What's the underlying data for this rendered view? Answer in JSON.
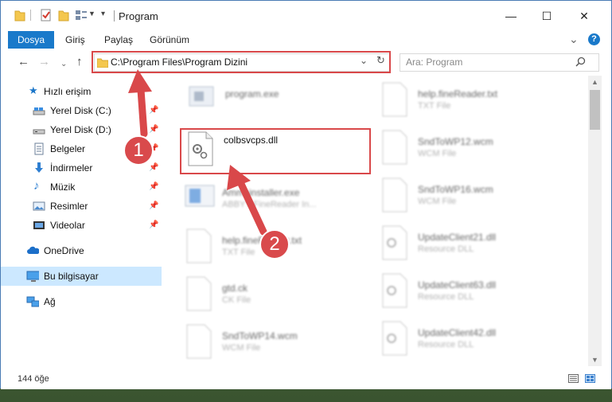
{
  "window": {
    "title": "Program"
  },
  "ribbon": {
    "tabs": {
      "file": "Dosya",
      "home": "Giriş",
      "share": "Paylaş",
      "view": "Görünüm"
    },
    "help": "?"
  },
  "navigation": {
    "address": "C:\\Program Files\\Program Dizini",
    "search_placeholder": "Ara: Program"
  },
  "sidebar": {
    "quick_access": "Hızlı erişim",
    "items": [
      {
        "label": "Yerel Disk (C:)",
        "icon": "drive-icon",
        "pinned": true
      },
      {
        "label": "Yerel Disk (D:)",
        "icon": "drive-icon",
        "pinned": true
      },
      {
        "label": "Belgeler",
        "icon": "documents-icon",
        "pinned": true
      },
      {
        "label": "İndirmeler",
        "icon": "download-icon",
        "pinned": true
      },
      {
        "label": "Müzik",
        "icon": "music-icon",
        "pinned": true
      },
      {
        "label": "Resimler",
        "icon": "pictures-icon",
        "pinned": true
      },
      {
        "label": "Videolar",
        "icon": "videos-icon",
        "pinned": true
      }
    ],
    "onedrive": "OneDrive",
    "this_pc": "Bu bilgisayar",
    "network": "Ağ"
  },
  "files": {
    "left": [
      {
        "name": "program.exe",
        "type": "",
        "icon": "exe-icon",
        "blurred": true
      },
      {
        "name": "colbsvcps.dll",
        "type": "",
        "icon": "dll-icon",
        "blurred": false
      },
      {
        "name": "Ammsinstaller.exe",
        "type": "ABBYY FineReader In...",
        "icon": "installer-icon",
        "blurred": true
      },
      {
        "name": "help.fineReader.txt",
        "type": "TXT File",
        "icon": "txt-icon",
        "blurred": true
      },
      {
        "name": "gtd.ck",
        "type": "CK File",
        "icon": "file-icon",
        "blurred": true
      },
      {
        "name": "SndToWP14.wcm",
        "type": "WCM File",
        "icon": "file-icon",
        "blurred": true
      }
    ],
    "right": [
      {
        "name": "help.fineReader.txt",
        "type": "TXT File",
        "icon": "txt-icon"
      },
      {
        "name": "SndToWP12.wcm",
        "type": "WCM File",
        "icon": "file-icon"
      },
      {
        "name": "SndToWP16.wcm",
        "type": "WCM File",
        "icon": "file-icon"
      },
      {
        "name": "UpdateClient21.dll",
        "type": "Resource DLL",
        "icon": "dll-icon"
      },
      {
        "name": "UpdateClient63.dll",
        "type": "Resource DLL",
        "icon": "dll-icon"
      },
      {
        "name": "UpdateClient42.dll",
        "type": "Resource DLL",
        "icon": "dll-icon"
      }
    ]
  },
  "status": {
    "item_count": "144 öğe"
  },
  "annotations": {
    "callout_1": "1",
    "callout_2": "2",
    "color": "#d9484a"
  }
}
